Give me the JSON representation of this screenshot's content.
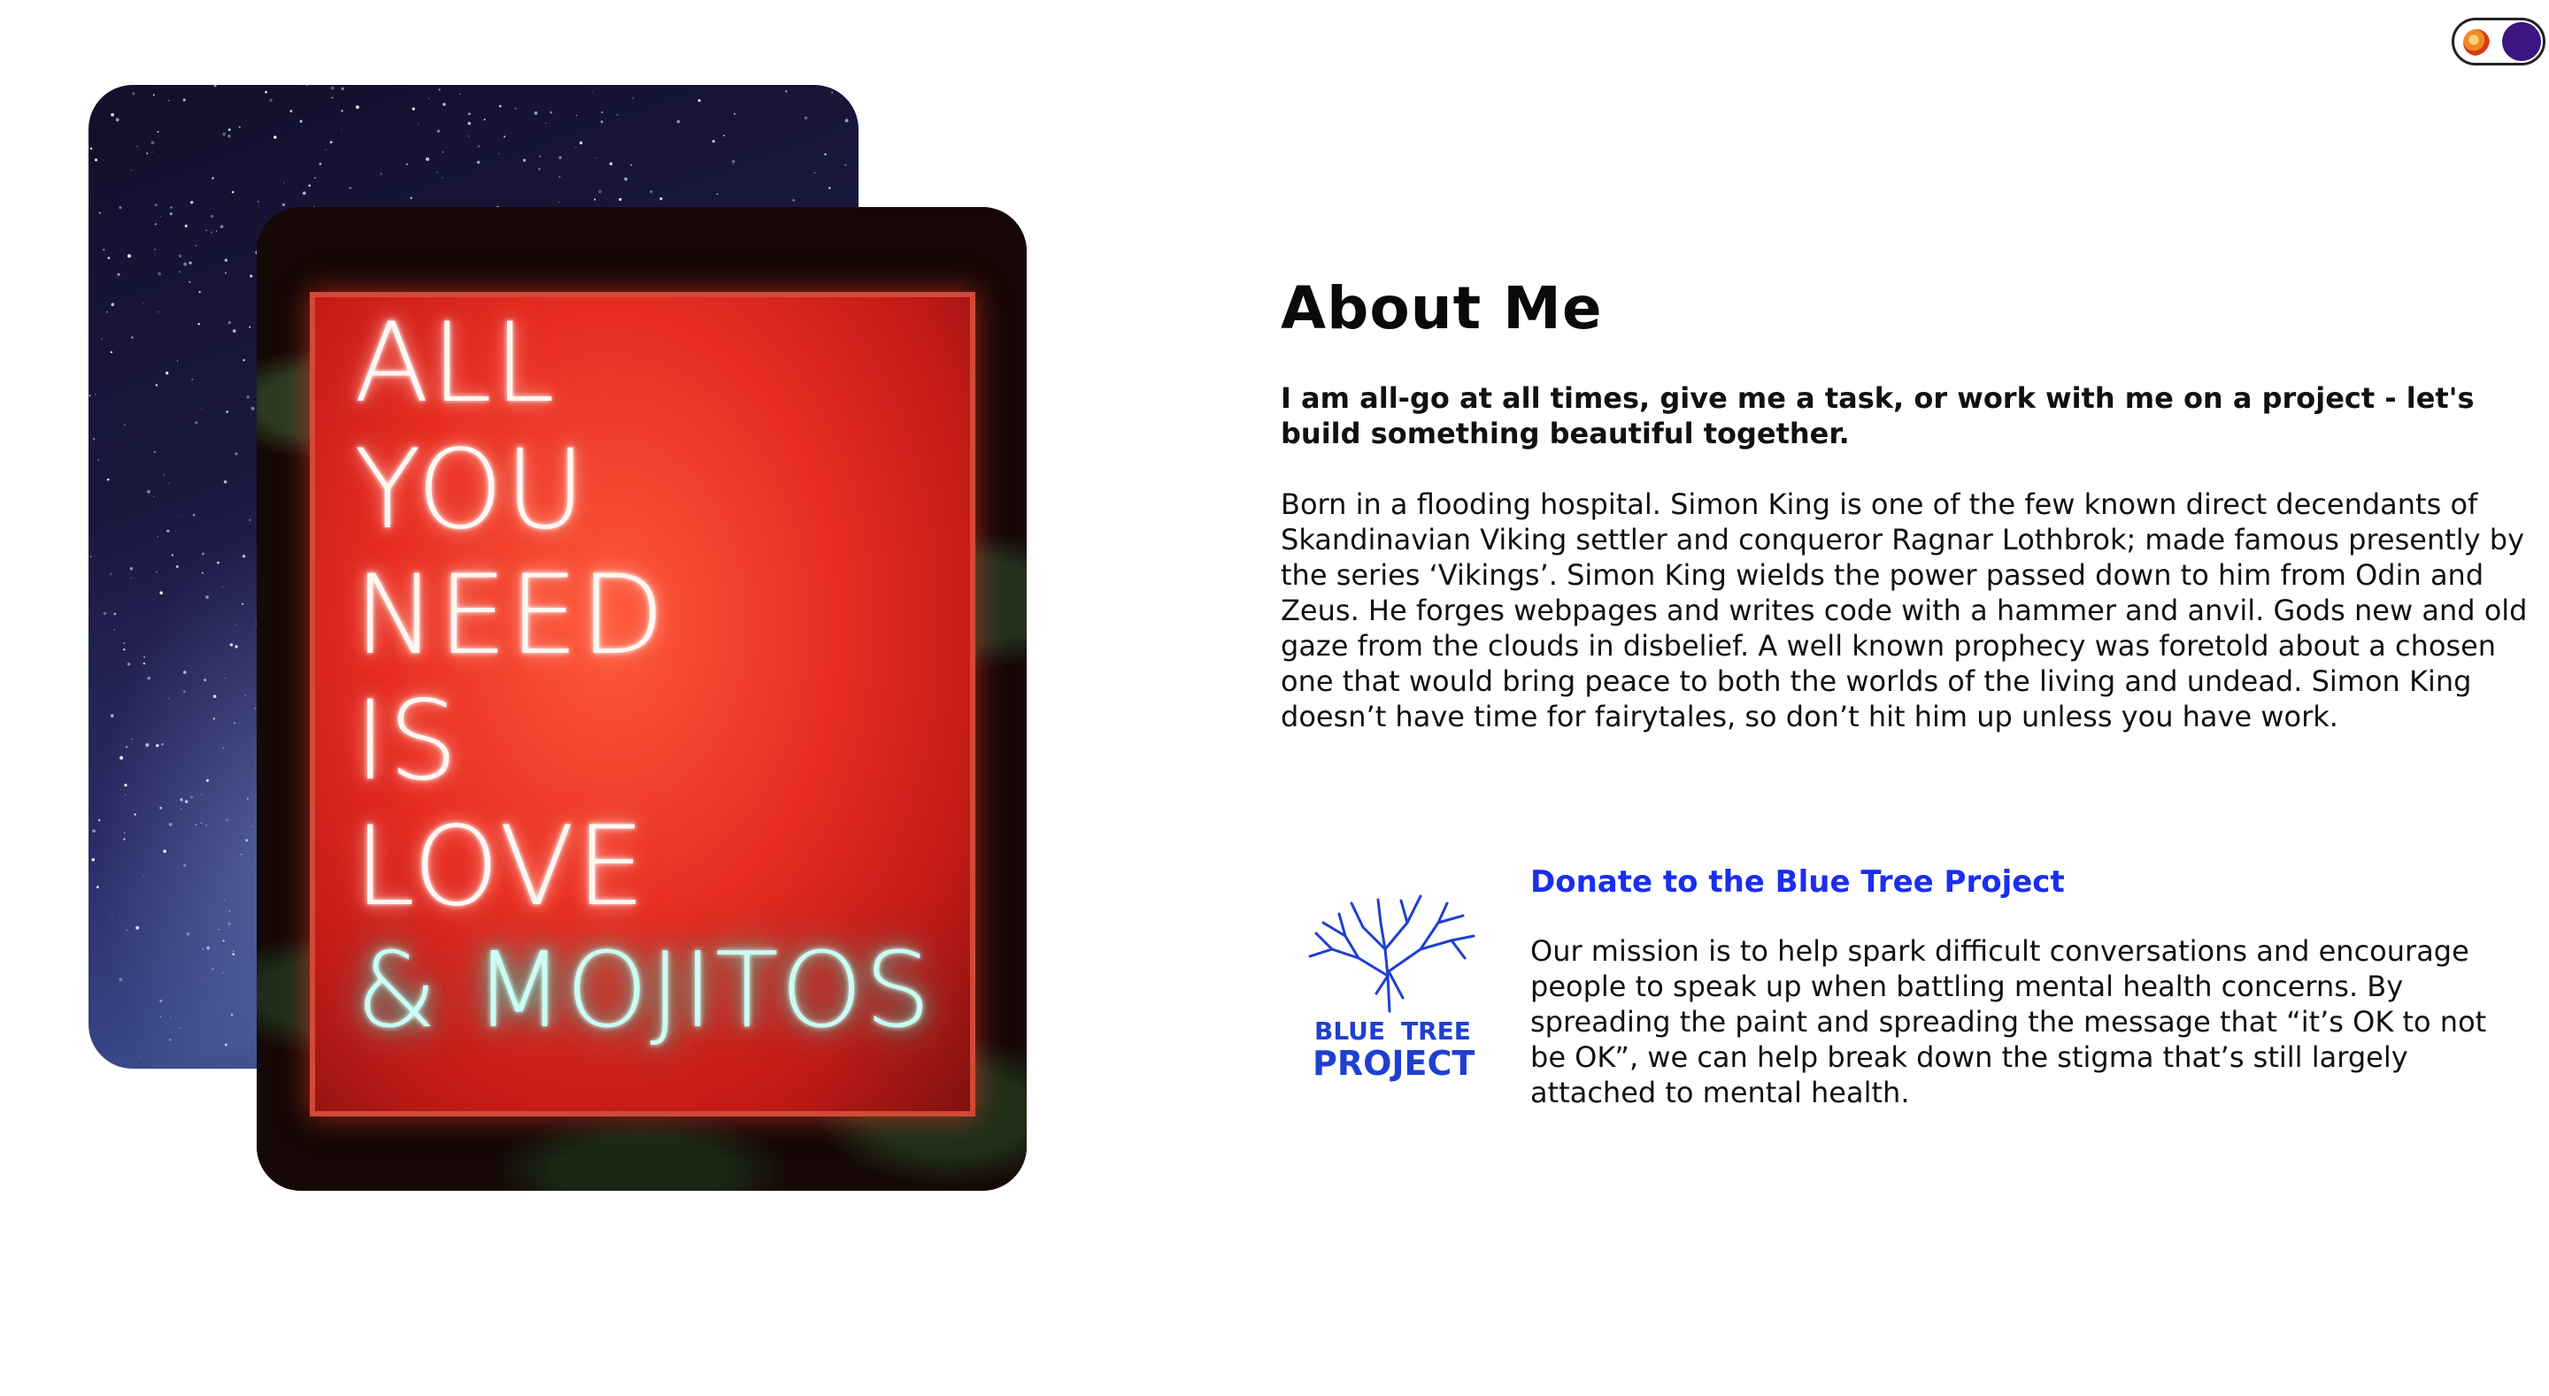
{
  "theme_toggle": {
    "state": "dark-mode-available"
  },
  "images": {
    "neon_sign": {
      "lines": [
        "ALL",
        "YOU",
        "NEED",
        "IS",
        "LOVE"
      ],
      "teal_line": "& MOJITOS"
    }
  },
  "about": {
    "title": "About Me",
    "intro": "I am all-go at all times, give me a task, or work with me on a project - let's build something beautiful together.",
    "bio": "Born in a flooding hospital. Simon King is one of the few known direct decendants of Skandinavian Viking settler and conqueror Ragnar Lothbrok; made famous presently by the series ‘Vikings’. Simon King wields the power passed down to him from Odin and Zeus. He forges webpages and writes code with a hammer and anvil. Gods new and old gaze from the clouds in disbelief. A well known prophecy was foretold about a chosen one that would bring peace to both the worlds of the living and undead. Simon King doesn’t have time for fairytales, so don’t hit him up unless you have work."
  },
  "donate": {
    "link_label": "Donate to the Blue Tree Project",
    "logo_text": {
      "line1_a": "BLUE",
      "line1_b": "TREE",
      "line2": "PROJECT"
    },
    "mission": "Our mission is to help spark difficult conversations and encourage people to speak up when battling mental health concerns. By spreading the paint and spreading the message that “it’s OK to not be OK”, we can help break down the stigma that’s still largely attached to mental health."
  },
  "colors": {
    "link": "#1a2ef0",
    "logo_blue": "#1e3fd0",
    "toggle_knob": "#3b1580"
  }
}
